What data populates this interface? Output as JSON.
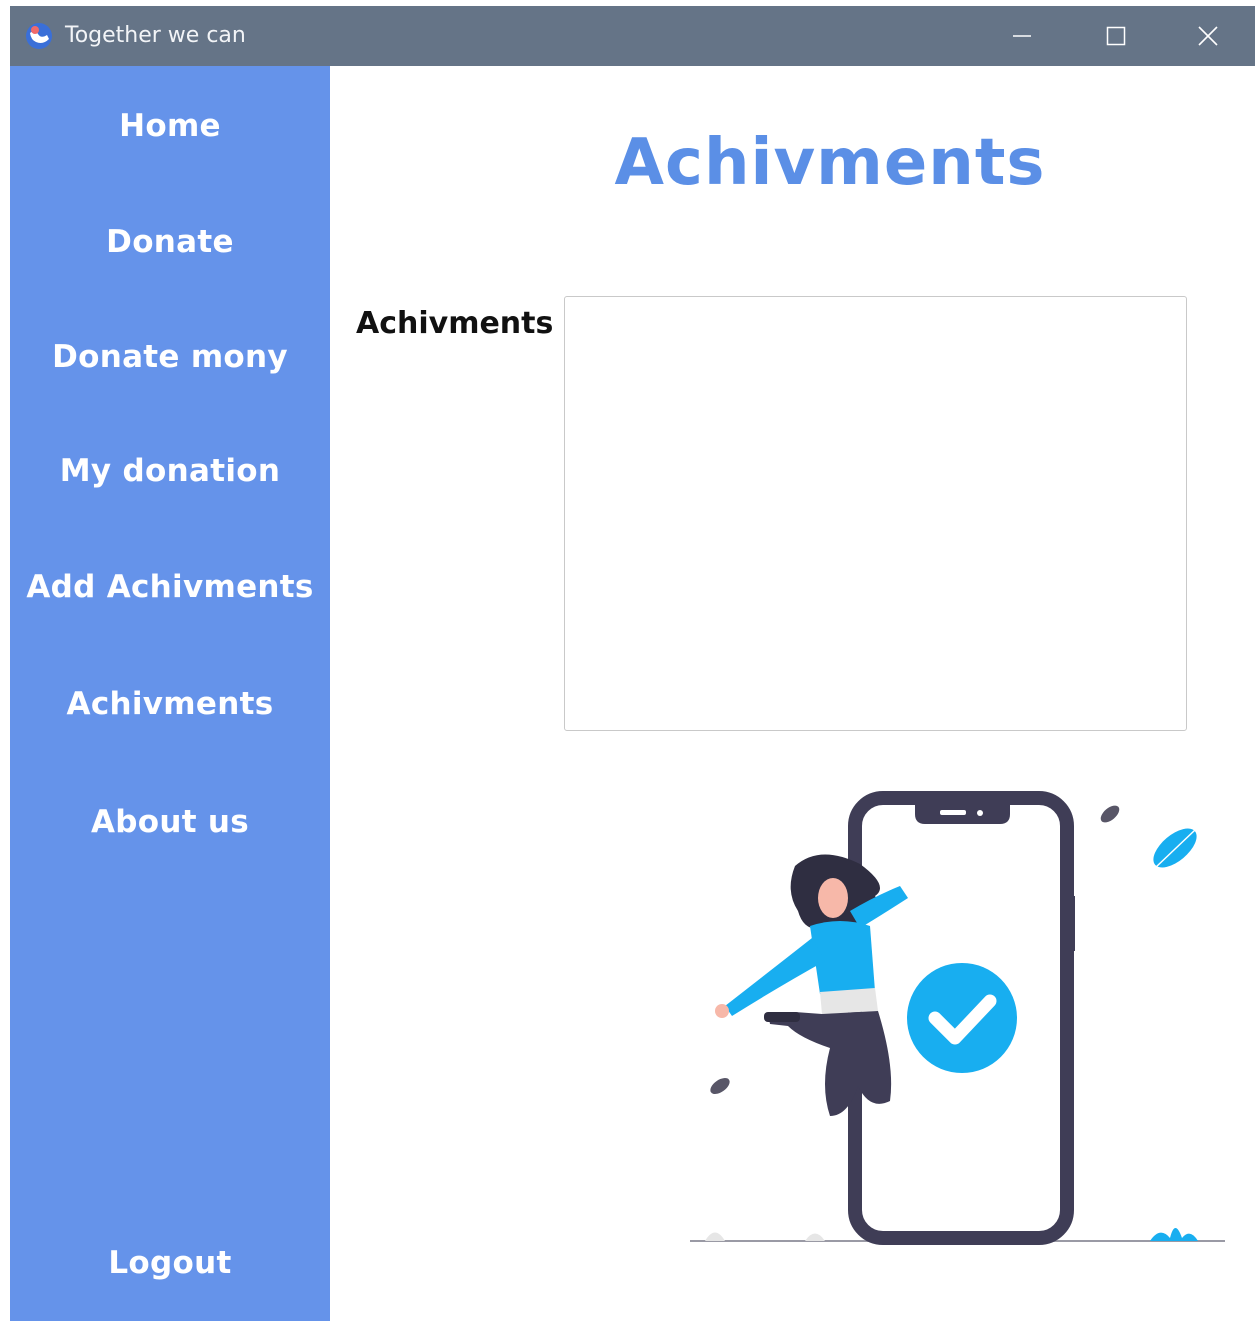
{
  "window": {
    "title": "Together we can",
    "icons": {
      "app": "app-globe-icon",
      "minimize": "minimize-icon",
      "maximize": "maximize-icon",
      "close": "close-icon"
    }
  },
  "sidebar": {
    "items": [
      {
        "label": "Home"
      },
      {
        "label": "Donate"
      },
      {
        "label": "Donate mony"
      },
      {
        "label": "My donation"
      },
      {
        "label": "Add Achivments"
      },
      {
        "label": "Achivments"
      },
      {
        "label": "About us"
      }
    ],
    "logout_label": "Logout"
  },
  "main": {
    "title": "Achivments",
    "field_label": "Achivments",
    "field_value": ""
  },
  "colors": {
    "titlebar": "#657487",
    "sidebar": "#6593ea",
    "title_accent": "#5b8fe6",
    "illustration_accent": "#18aef0",
    "illustration_dark": "#3f3d56"
  }
}
